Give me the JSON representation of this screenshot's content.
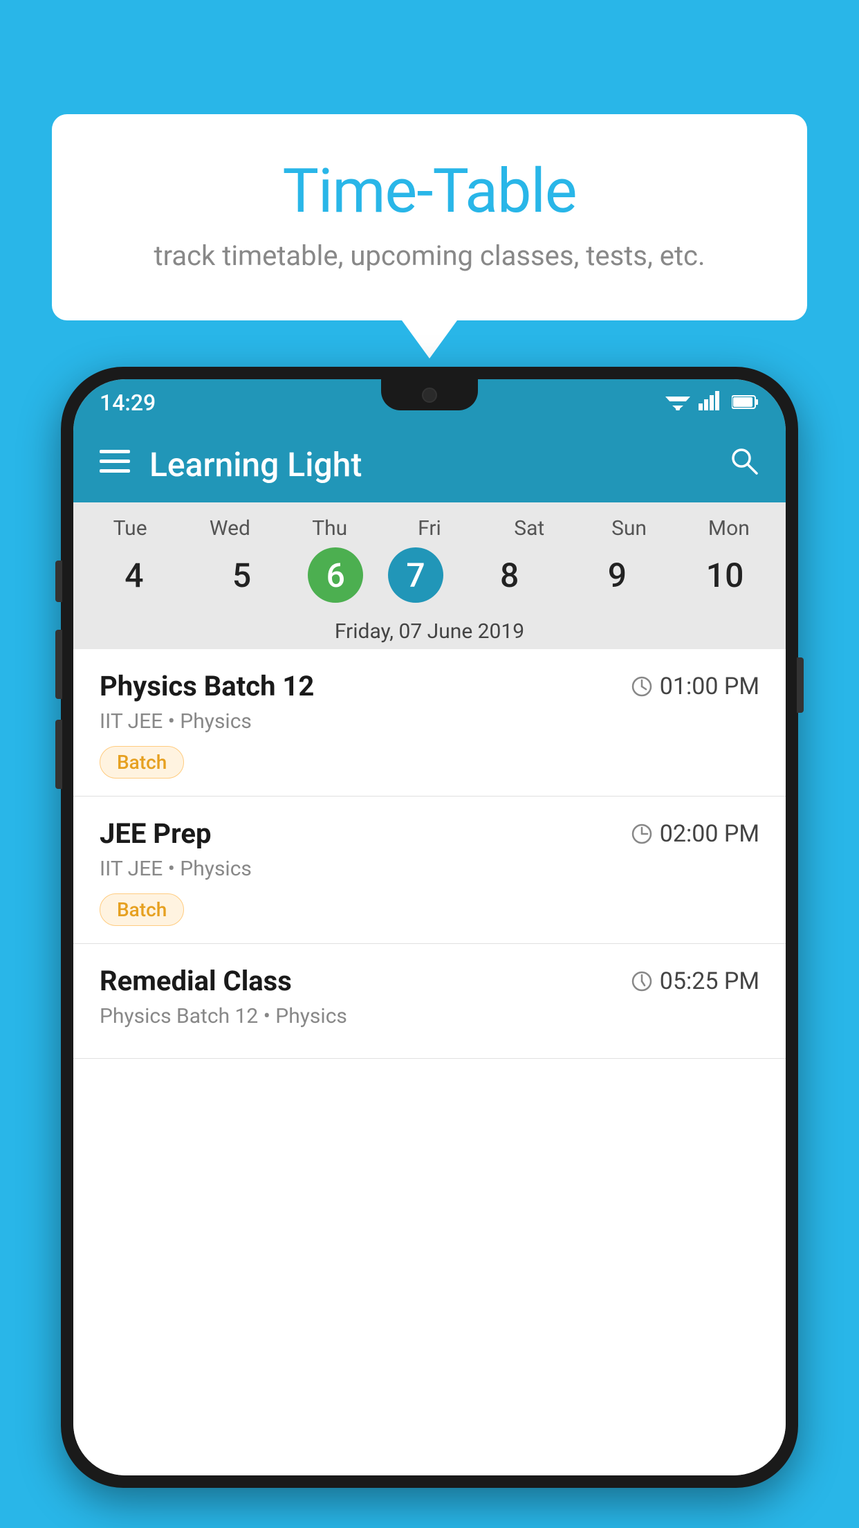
{
  "page": {
    "background_color": "#29b6e8"
  },
  "speech_bubble": {
    "title": "Time-Table",
    "subtitle": "track timetable, upcoming classes, tests, etc."
  },
  "status_bar": {
    "time": "14:29"
  },
  "app_bar": {
    "title": "Learning Light"
  },
  "calendar": {
    "days": [
      {
        "label": "Tue",
        "number": "4"
      },
      {
        "label": "Wed",
        "number": "5"
      },
      {
        "label": "Thu",
        "number": "6",
        "state": "today"
      },
      {
        "label": "Fri",
        "number": "7",
        "state": "selected"
      },
      {
        "label": "Sat",
        "number": "8"
      },
      {
        "label": "Sun",
        "number": "9"
      },
      {
        "label": "Mon",
        "number": "10"
      }
    ],
    "selected_date_label": "Friday, 07 June 2019"
  },
  "schedule_items": [
    {
      "title": "Physics Batch 12",
      "time": "01:00 PM",
      "subtitle": "IIT JEE • Physics",
      "badge": "Batch"
    },
    {
      "title": "JEE Prep",
      "time": "02:00 PM",
      "subtitle": "IIT JEE • Physics",
      "badge": "Batch"
    },
    {
      "title": "Remedial Class",
      "time": "05:25 PM",
      "subtitle": "Physics Batch 12 • Physics",
      "badge": ""
    }
  ],
  "labels": {
    "hamburger": "☰",
    "search": "🔍",
    "clock": "🕐",
    "wifi": "▾",
    "signal": "▲",
    "battery": "▮"
  }
}
